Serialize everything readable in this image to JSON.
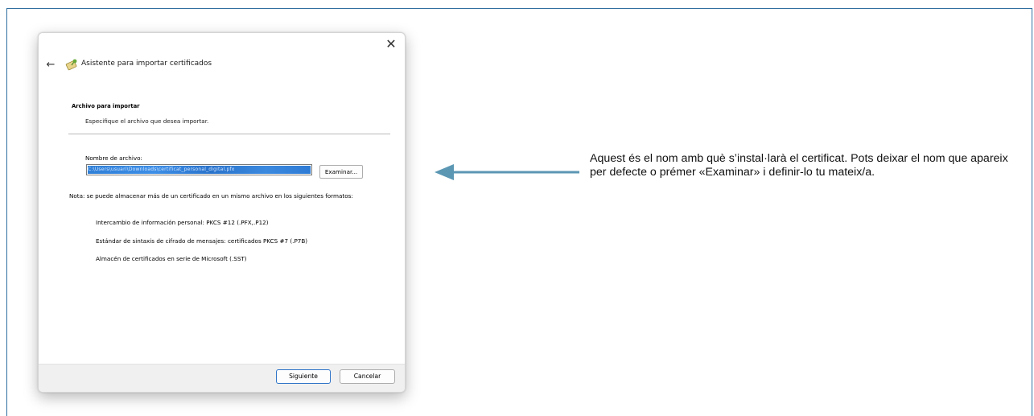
{
  "dialog": {
    "title": "Asistente para importar certificados",
    "close_glyph": "✕",
    "back_glyph": "←",
    "section_title": "Archivo para importar",
    "section_subtitle": "Especifique el archivo que desea importar.",
    "file_label": "Nombre de archivo:",
    "file_value": "C:\\Users\\usuari\\Downloads\\certificat_personal_digital.pfx",
    "browse_label": "Examinar...",
    "note": "Nota: se puede almacenar más de un certificado en un mismo archivo en los siguientes formatos:",
    "formats": [
      "Intercambio de información personal: PKCS #12 (.PFX,.P12)",
      "Estándar de sintaxis de cifrado de mensajes: certificados PKCS #7 (.P7B)",
      "Almacén de certificados en serie de Microsoft (.SST)"
    ],
    "next_label": "Siguiente",
    "cancel_label": "Cancelar"
  },
  "annotation": {
    "text": "Aquest és el nom amb què s’instal·larà el certificat. Pots deixar el nom que apareix per defecte o prémer «Examinar» i definir-lo tu mateix/a."
  },
  "colors": {
    "frame": "#2f6ea0",
    "arrow": "#5b97b3",
    "selection": "#2f7fd7",
    "primary_button_border": "#2f74c8"
  },
  "icons": {
    "wizard": "certificate-wizard-icon",
    "back": "back-arrow-icon",
    "close": "close-icon",
    "pointer": "left-arrow-pointer-icon"
  }
}
